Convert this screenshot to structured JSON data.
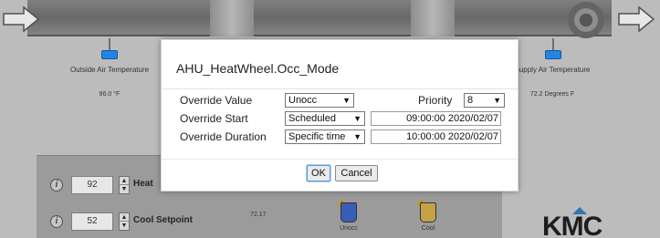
{
  "background": {
    "sensors": [
      {
        "label": "Outside Air Temperature",
        "value": "86.0 °F"
      },
      {
        "label": "Supply Air Temperature",
        "value": "72.2 Degrees F"
      }
    ],
    "setpoints": [
      {
        "value": "92",
        "label": "Heat"
      },
      {
        "value": "52",
        "label": "Cool Setpoint",
        "reading": "72.17"
      }
    ],
    "modes": [
      {
        "label": "Unocc",
        "color": "#3a63c9"
      },
      {
        "label": "Cool",
        "color": "#d9b14a"
      }
    ],
    "logo": "KMC"
  },
  "dialog": {
    "title": "AHU_HeatWheel.Occ_Mode",
    "override_value_label": "Override Value",
    "override_value": "Unocc",
    "priority_label": "Priority",
    "priority": "8",
    "override_start_label": "Override Start",
    "override_start_mode": "Scheduled",
    "override_start_datetime": "09:00:00 2020/02/07",
    "override_duration_label": "Override Duration",
    "override_duration_mode": "Specific time",
    "override_duration_datetime": "10:00:00 2020/02/07",
    "ok_label": "OK",
    "cancel_label": "Cancel"
  },
  "icons": {
    "caret": "▼",
    "up": "▲",
    "down": "▼",
    "info": "i"
  }
}
